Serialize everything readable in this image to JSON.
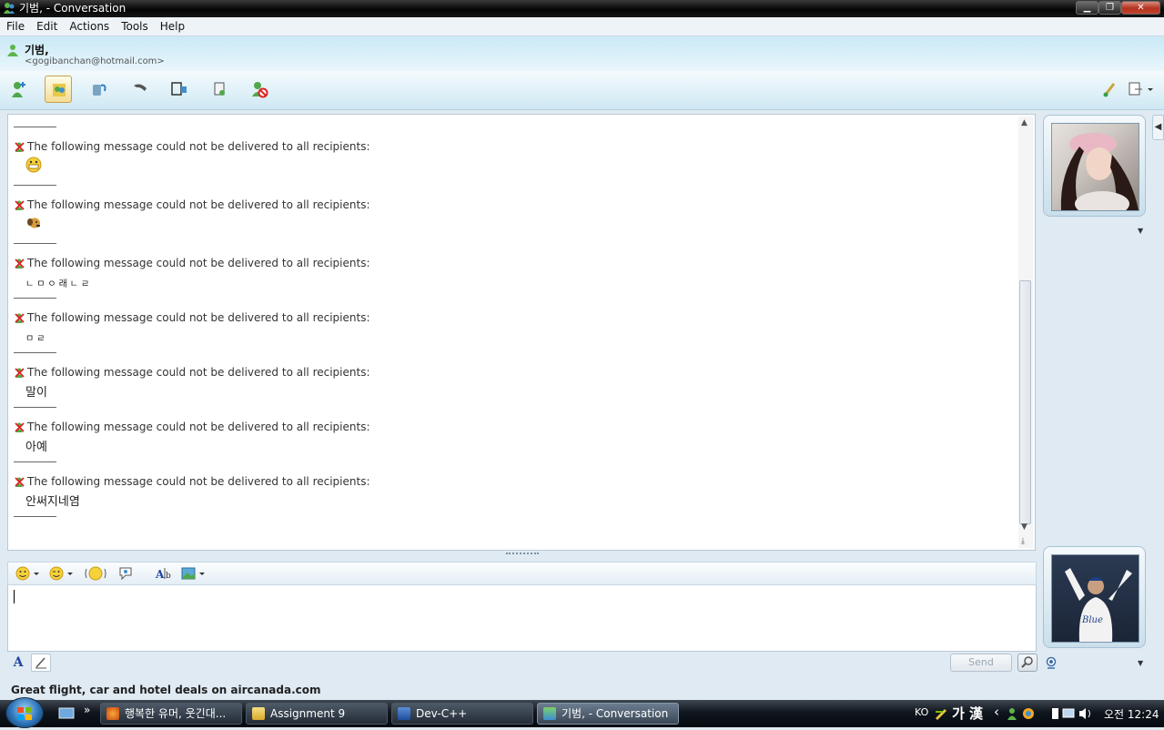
{
  "window": {
    "title": "기범, - Conversation"
  },
  "menus": [
    "File",
    "Edit",
    "Actions",
    "Tools",
    "Help"
  ],
  "contact": {
    "name": "기범,",
    "email": "<gogibanchan@hotmail.com>"
  },
  "toolbar_icons": [
    "invite-contact-icon",
    "share-files-icon",
    "video-call-icon",
    "call-icon",
    "webcam-icon",
    "games-icon",
    "block-icon"
  ],
  "messages": [
    {
      "notice": "The following message could not be delivered to all recipients:",
      "content": "",
      "emoticon": "grin-emoticon"
    },
    {
      "notice": "The following message could not be delivered to all recipients:",
      "content": "",
      "emoticon": "dog-emoticon"
    },
    {
      "notice": "The following message could not be delivered to all recipients:",
      "content": "ㄴㅁㅇ래ㄴㄹ",
      "emoticon": ""
    },
    {
      "notice": "The following message could not be delivered to all recipients:",
      "content": "ㅁㄹ",
      "emoticon": ""
    },
    {
      "notice": "The following message could not be delivered to all recipients:",
      "content": "말이",
      "emoticon": ""
    },
    {
      "notice": "The following message could not be delivered to all recipients:",
      "content": "아예",
      "emoticon": ""
    },
    {
      "notice": "The following message could not be delivered to all recipients:",
      "content": "안써지네염",
      "emoticon": ""
    }
  ],
  "compose": {
    "value": "",
    "send_label": "Send"
  },
  "ad_text": "Great flight, car and hotel deals on aircanada.com",
  "taskbar": {
    "chevron": "»",
    "items": [
      {
        "label": "행복한 유머, 웃긴대...",
        "icon": "firefox-icon",
        "active": false
      },
      {
        "label": "Assignment 9",
        "icon": "folder-icon",
        "active": false
      },
      {
        "label": "Dev-C++",
        "icon": "devcpp-icon",
        "active": false
      },
      {
        "label": "기범, - Conversation",
        "icon": "messenger-icon",
        "active": true
      }
    ],
    "lang": "KO",
    "ime": "가 漢",
    "clock": "오전 12:24"
  },
  "colors": {
    "accent": "#c9e9f6",
    "error": "#cc2222",
    "link": "#2046a0"
  }
}
